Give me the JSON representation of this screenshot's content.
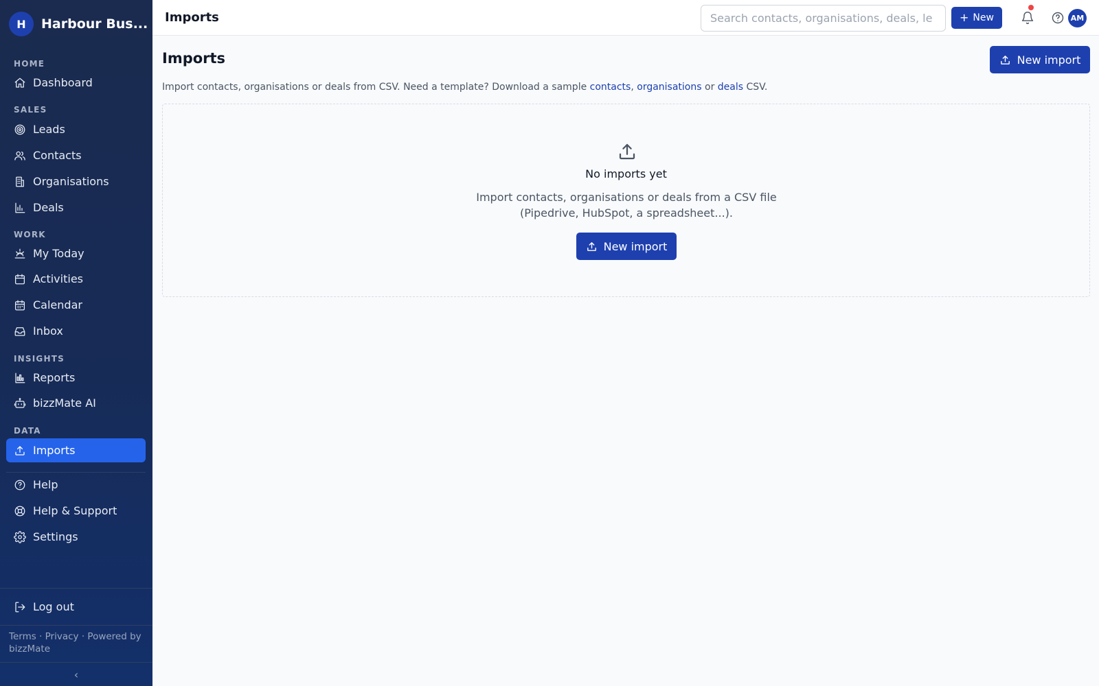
{
  "app": {
    "org_initial": "H",
    "org_name": "Harbour Bus..."
  },
  "sidebar": {
    "sections": [
      {
        "title": "HOME"
      },
      {
        "title": "SALES"
      },
      {
        "title": "WORK"
      },
      {
        "title": "INSIGHTS"
      },
      {
        "title": "DATA"
      }
    ],
    "items": [
      {
        "label": "Dashboard",
        "icon": "home-icon"
      },
      {
        "label": "Leads",
        "icon": "target-icon"
      },
      {
        "label": "Contacts",
        "icon": "users-icon"
      },
      {
        "label": "Organisations",
        "icon": "building-icon"
      },
      {
        "label": "Deals",
        "icon": "bar-chart-icon"
      },
      {
        "label": "My Today",
        "icon": "sunrise-icon"
      },
      {
        "label": "Activities",
        "icon": "calendar-icon"
      },
      {
        "label": "Calendar",
        "icon": "calendar-grid-icon"
      },
      {
        "label": "Inbox",
        "icon": "inbox-icon"
      },
      {
        "label": "Reports",
        "icon": "reports-icon"
      },
      {
        "label": "bizzMate AI",
        "icon": "bot-icon"
      },
      {
        "label": "Imports",
        "icon": "upload-icon",
        "active": true
      },
      {
        "label": "Help",
        "icon": "help-circle-icon"
      },
      {
        "label": "Help & Support",
        "icon": "life-buoy-icon"
      },
      {
        "label": "Settings",
        "icon": "gear-icon"
      }
    ],
    "logout_label": "Log out",
    "footer": {
      "terms": "Terms",
      "privacy": "Privacy",
      "powered": "Powered by bizzMate",
      "sep": " · "
    },
    "collapse_glyph": "‹"
  },
  "topbar": {
    "title": "Imports",
    "search_placeholder": "Search contacts, organisations, deals, le",
    "new_label": "New",
    "user_initials": "AM"
  },
  "main": {
    "title": "Imports",
    "new_import_label": "New import",
    "subtitle": {
      "prefix": "Import contacts, organisations or deals from CSV. Need a template? Download a sample ",
      "link_contacts": "contacts",
      "comma": ", ",
      "link_organisations": "organisations",
      "or": " or ",
      "link_deals": "deals",
      "suffix": " CSV."
    },
    "empty": {
      "title": "No imports yet",
      "description": "Import contacts, organisations or deals from a CSV file (Pipedrive, HubSpot, a spreadsheet...).",
      "button_label": "New import"
    }
  },
  "colors": {
    "accent": "#1e40af",
    "active_nav": "#2563eb",
    "sidebar_bg": "#172b57",
    "notification": "#ef4444"
  }
}
